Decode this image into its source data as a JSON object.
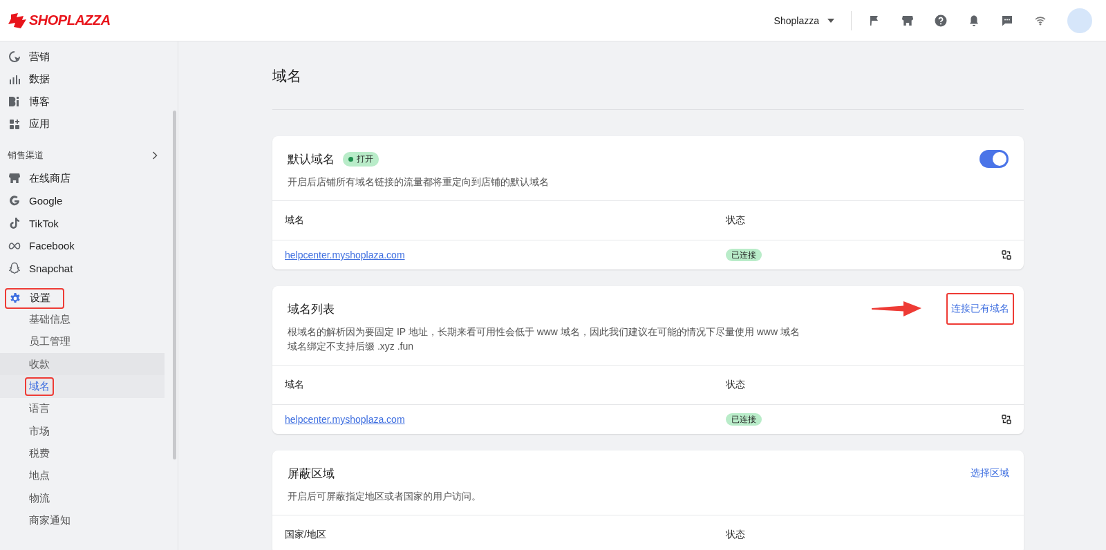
{
  "brand": {
    "name": "SHOPLAZZA"
  },
  "header": {
    "store_name": "Shoplazza"
  },
  "sidebar": {
    "top_items": [
      {
        "label": "营销",
        "kind": "marketing"
      },
      {
        "label": "数据",
        "kind": "data"
      },
      {
        "label": "博客",
        "kind": "blog"
      },
      {
        "label": "应用",
        "kind": "apps"
      }
    ],
    "section_title": "销售渠道",
    "channels": [
      {
        "label": "在线商店",
        "kind": "store"
      },
      {
        "label": "Google",
        "kind": "google"
      },
      {
        "label": "TikTok",
        "kind": "tiktok"
      },
      {
        "label": "Facebook",
        "kind": "meta"
      },
      {
        "label": "Snapchat",
        "kind": "snapchat"
      }
    ],
    "settings": {
      "label": "设置",
      "highlighted": true,
      "children": [
        {
          "label": "基础信息",
          "selected": false,
          "hovered": false,
          "highlighted": false
        },
        {
          "label": "员工管理",
          "selected": false,
          "hovered": false,
          "highlighted": false
        },
        {
          "label": "收款",
          "selected": false,
          "hovered": true,
          "highlighted": false
        },
        {
          "label": "域名",
          "selected": true,
          "hovered": false,
          "highlighted": true
        },
        {
          "label": "语言",
          "selected": false,
          "hovered": false,
          "highlighted": false
        },
        {
          "label": "市场",
          "selected": false,
          "hovered": false,
          "highlighted": false
        },
        {
          "label": "税费",
          "selected": false,
          "hovered": false,
          "highlighted": false
        },
        {
          "label": "地点",
          "selected": false,
          "hovered": false,
          "highlighted": false
        },
        {
          "label": "物流",
          "selected": false,
          "hovered": false,
          "highlighted": false
        },
        {
          "label": "商家通知",
          "selected": false,
          "hovered": false,
          "highlighted": false
        }
      ]
    }
  },
  "page": {
    "title": "域名"
  },
  "cards": [
    {
      "title": "默认域名",
      "badge": "打开",
      "toggle": {
        "on": true
      },
      "description": [
        "开启后店铺所有域名链接的流量都将重定向到店铺的默认域名"
      ],
      "table": {
        "columns": [
          "域名",
          "状态"
        ],
        "rows": [
          {
            "domain": "helpcenter.myshoplaza.com",
            "status": "已连接"
          }
        ]
      }
    },
    {
      "title": "域名列表",
      "action": {
        "label": "连接已有域名",
        "highlighted": true,
        "arrow": true
      },
      "description": [
        "根域名的解析因为要固定 IP 地址，长期来看可用性会低于 www 域名，因此我们建议在可能的情况下尽量使用 www 域名",
        "域名绑定不支持后缀 .xyz .fun"
      ],
      "table": {
        "columns": [
          "域名",
          "状态"
        ],
        "rows": [
          {
            "domain": "helpcenter.myshoplaza.com",
            "status": "已连接"
          }
        ]
      }
    },
    {
      "title": "屏蔽区域",
      "action": {
        "label": "选择区域",
        "highlighted": false,
        "arrow": false
      },
      "description": [
        "开启后可屏蔽指定地区或者国家的用户访问。"
      ],
      "table": {
        "columns": [
          "国家/地区",
          "状态"
        ]
      }
    }
  ]
}
